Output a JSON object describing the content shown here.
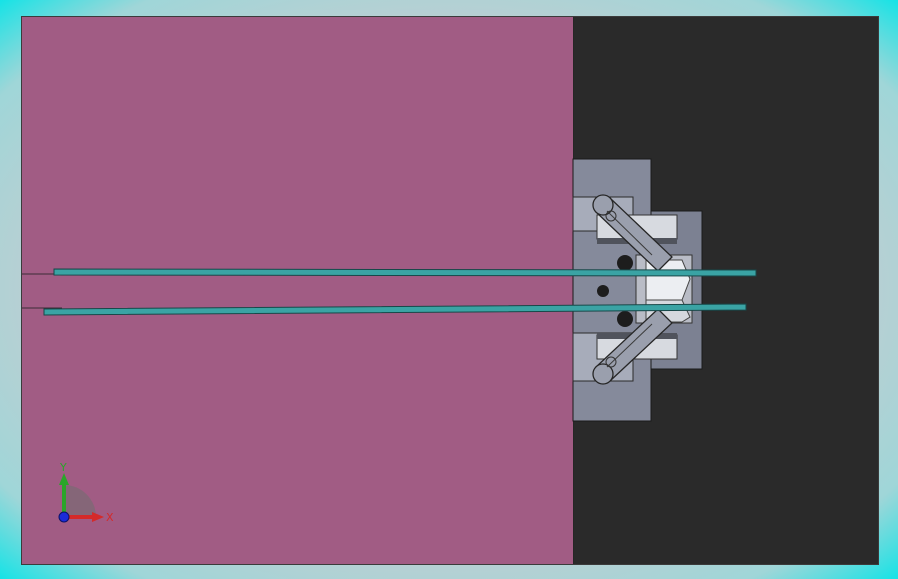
{
  "triad": {
    "x_label": "X",
    "y_label": "Y"
  },
  "colors": {
    "background_glow": "#15e3e6",
    "viewport": "#2a2a2a",
    "plate": "#a15c84",
    "part_gray": "#858a9b",
    "rod": "#3aa3a4"
  },
  "icons": {
    "view_triad": "axis-triad-icon"
  }
}
